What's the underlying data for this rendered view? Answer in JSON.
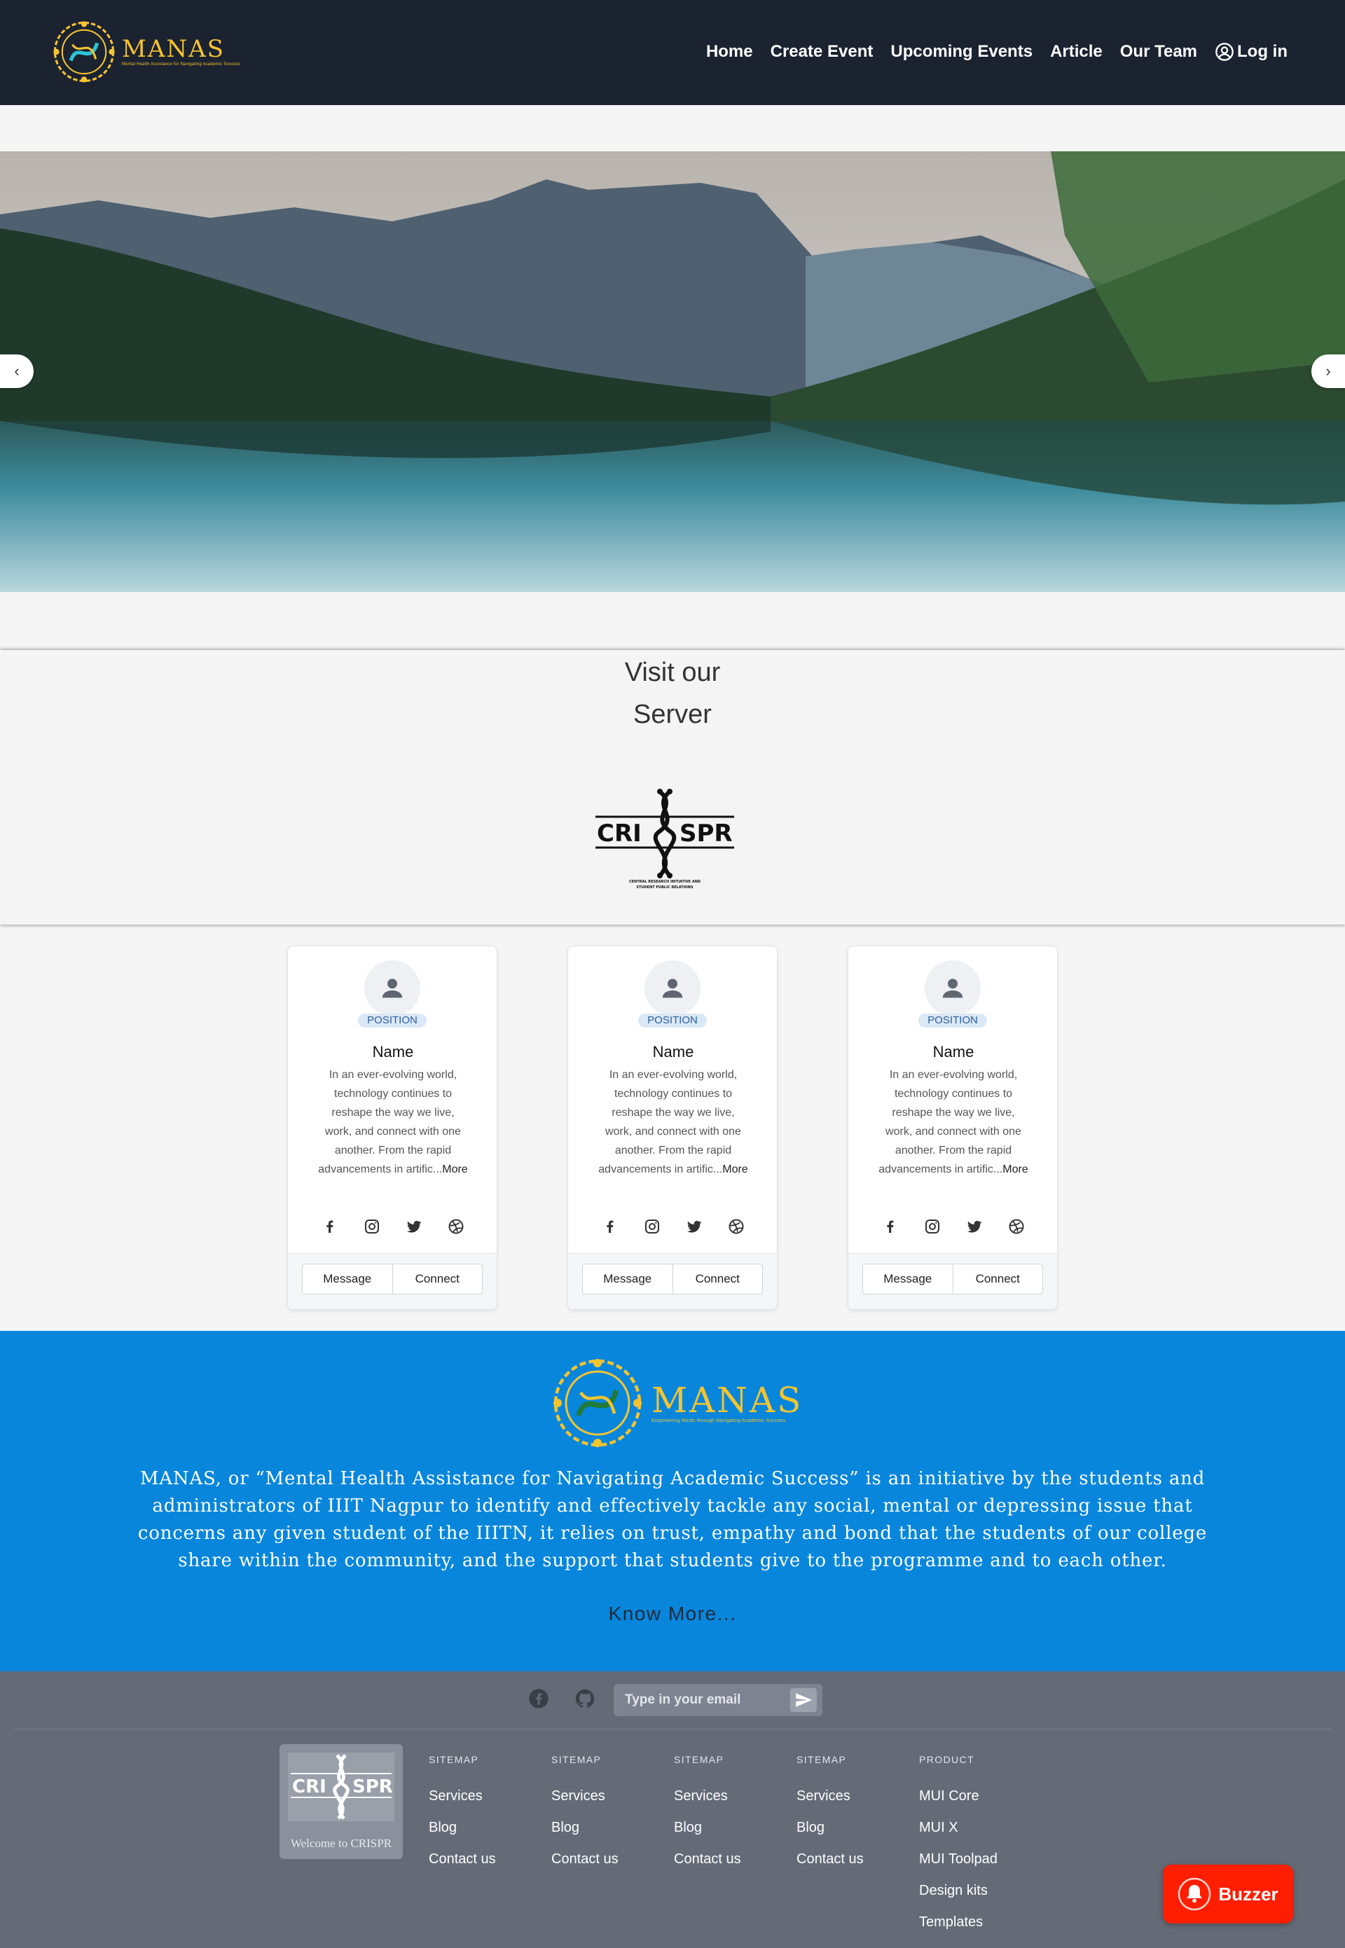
{
  "brand": {
    "name": "MANAS",
    "tagline": "Mental Health Assistance for Navigating Academic Success"
  },
  "nav": {
    "links": [
      "Home",
      "Create Event",
      "Upcoming Events",
      "Article",
      "Our Team"
    ],
    "login_label": "Log in"
  },
  "hero": {
    "prev_icon": "chevron-left-icon",
    "next_icon": "chevron-right-icon"
  },
  "server": {
    "title_line1": "Visit our",
    "title_line2": "Server",
    "logo_left": "CRI",
    "logo_right": "SPR",
    "logo_caption_1": "CENTRAL RESEARCH INITIATIVE AND",
    "logo_caption_2": "STUDENT PUBLIC RELATIONS"
  },
  "cards": [
    {
      "position": "POSITION",
      "name": "Name",
      "desc": "In an ever-evolving world, technology continues to reshape the way we live, work, and connect with one another. From the rapid advancements in artific...",
      "more": "More",
      "message_label": "Message",
      "connect_label": "Connect"
    },
    {
      "position": "POSITION",
      "name": "Name",
      "desc": "In an ever-evolving world, technology continues to reshape the way we live, work, and connect with one another. From the rapid advancements in artific...",
      "more": "More",
      "message_label": "Message",
      "connect_label": "Connect"
    },
    {
      "position": "POSITION",
      "name": "Name",
      "desc": "In an ever-evolving world, technology continues to reshape the way we live, work, and connect with one another. From the rapid advancements in artific...",
      "more": "More",
      "message_label": "Message",
      "connect_label": "Connect"
    }
  ],
  "card_socials": [
    "facebook-icon",
    "instagram-icon",
    "twitter-icon",
    "dribbble-icon"
  ],
  "about": {
    "text": "MANAS, or “Mental Health Assistance for Navigating Academic Success” is an initiative by the students and administrators of IIIT Nagpur to identify and effectively tackle any social, mental or depressing issue that concerns any given student of the IIITN, it relies on trust, empathy and bond that the students of our college share within the community, and the support that students give to the programme and to each other.",
    "know_more": "Know More...",
    "tagline": "Empowering Minds through Navigating Academic Success"
  },
  "footer": {
    "email_placeholder": "Type in your email",
    "brand_caption": "Welcome to CRISPR",
    "columns": [
      {
        "title": "SITEMAP",
        "links": [
          "Services",
          "Blog",
          "Contact us"
        ]
      },
      {
        "title": "SITEMAP",
        "links": [
          "Services",
          "Blog",
          "Contact us"
        ]
      },
      {
        "title": "SITEMAP",
        "links": [
          "Services",
          "Blog",
          "Contact us"
        ]
      },
      {
        "title": "SITEMAP",
        "links": [
          "Services",
          "Blog",
          "Contact us"
        ]
      },
      {
        "title": "PRODUCT",
        "links": [
          "MUI Core",
          "MUI X",
          "MUI Toolpad",
          "Design kits",
          "Templates"
        ]
      }
    ]
  },
  "buzzer": {
    "label": "Buzzer"
  },
  "colors": {
    "navbar": "#1b2230",
    "accent_gold": "#f4c430",
    "about_blue": "#0786dc",
    "footer": "#646b77",
    "buzzer": "#ff1e00"
  }
}
